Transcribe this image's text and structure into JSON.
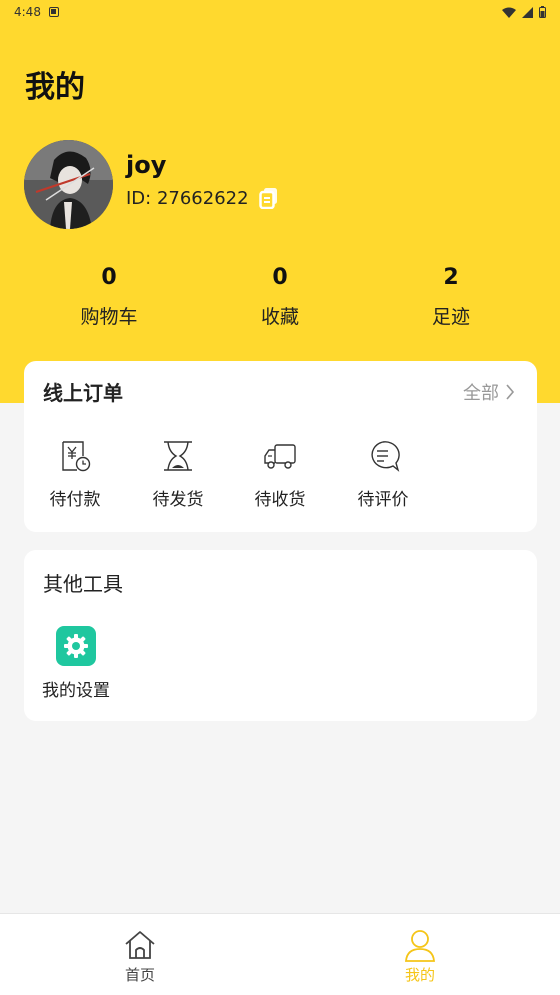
{
  "status_bar": {
    "time": "4:48"
  },
  "page_title": "我的",
  "user": {
    "name": "joy",
    "id_text": "ID: 27662622"
  },
  "stats": [
    {
      "count": "0",
      "label": "购物车"
    },
    {
      "count": "0",
      "label": "收藏"
    },
    {
      "count": "2",
      "label": "足迹"
    }
  ],
  "orders": {
    "title": "线上订单",
    "all_label": "全部",
    "items": [
      {
        "label": "待付款",
        "icon": "pending-payment-icon"
      },
      {
        "label": "待发货",
        "icon": "pending-shipment-icon"
      },
      {
        "label": "待收货",
        "icon": "pending-receipt-icon"
      },
      {
        "label": "待评价",
        "icon": "pending-review-icon"
      }
    ]
  },
  "tools": {
    "title": "其他工具",
    "items": [
      {
        "label": "我的设置",
        "icon": "gear-icon"
      }
    ]
  },
  "tab_bar": {
    "items": [
      {
        "label": "首页",
        "icon": "home-icon",
        "active": false
      },
      {
        "label": "我的",
        "icon": "user-icon",
        "active": true
      }
    ]
  },
  "colors": {
    "brand_yellow": "#ffd92e",
    "settings_green": "#1fc79f",
    "active_tab": "#f5c518",
    "inactive_tab": "#444444"
  }
}
